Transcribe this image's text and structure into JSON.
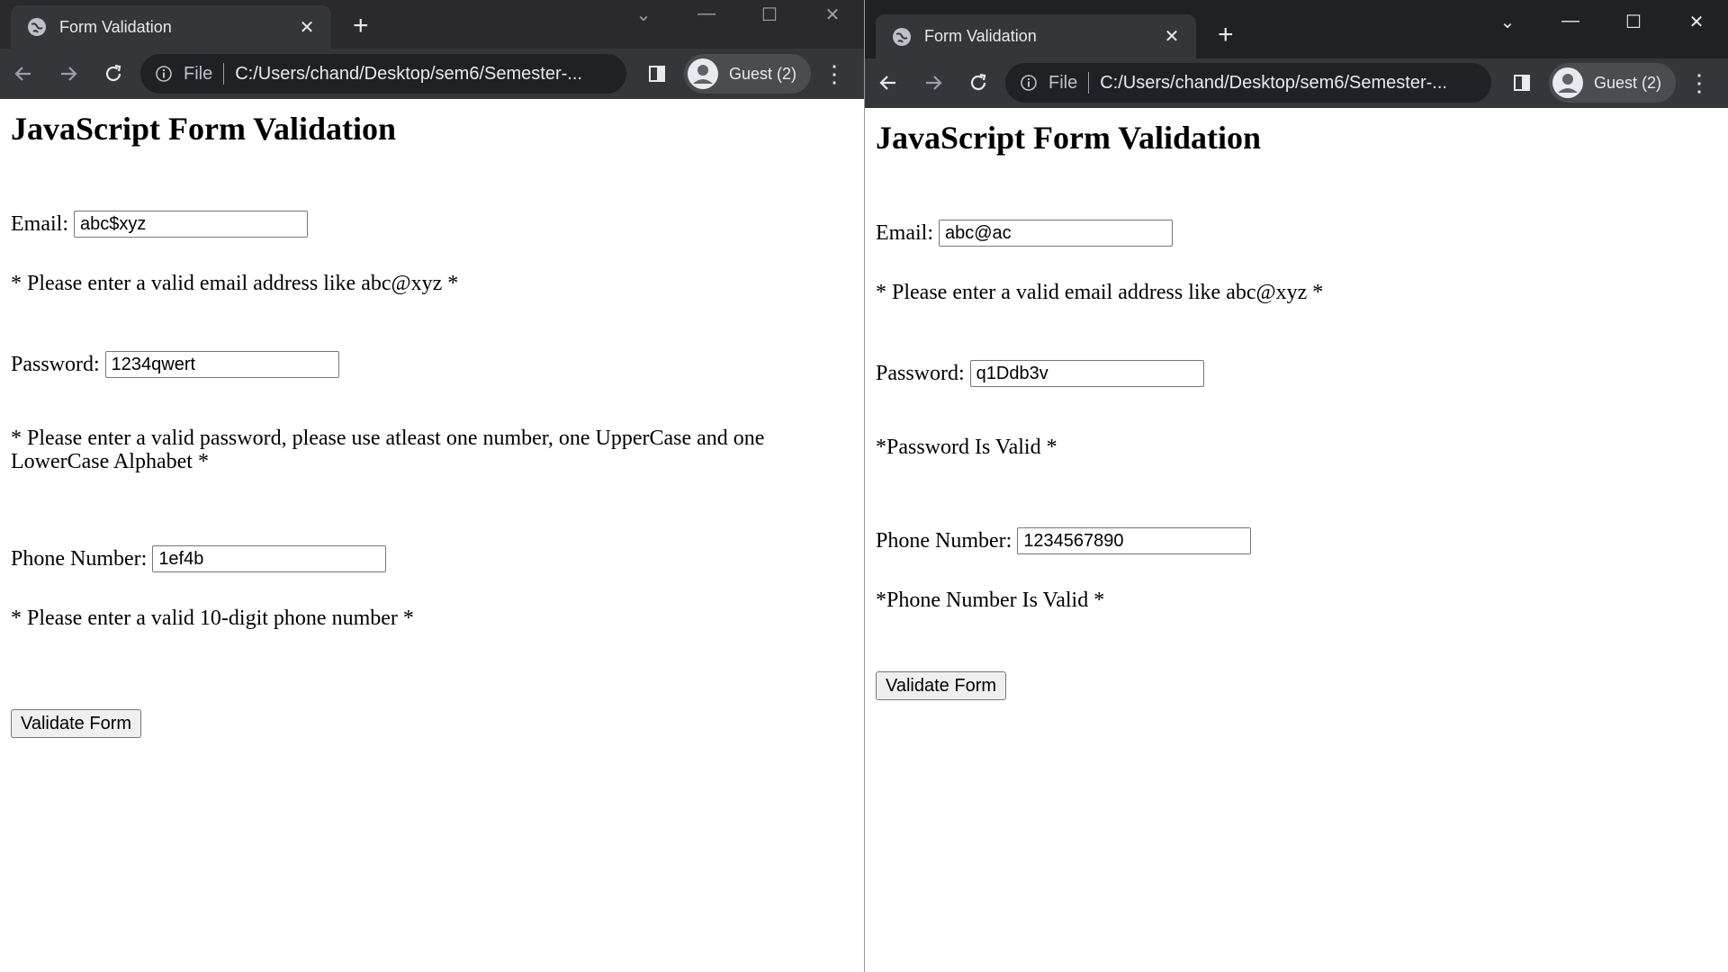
{
  "left_window": {
    "tab_title": "Form Validation",
    "url_scheme": "File",
    "url": "C:/Users/chand/Desktop/sem6/Semester-...",
    "profile_label": "Guest (2)",
    "page": {
      "heading": "JavaScript Form Validation",
      "email_label": "Email:",
      "email_value": "abc$xyz",
      "email_message": "* Please enter a valid email address like abc@xyz *",
      "password_label": "Password:",
      "password_value": "1234qwert",
      "password_message": "* Please enter a valid password, please use atleast one number, one UpperCase and one LowerCase Alphabet *",
      "phone_label": "Phone Number:",
      "phone_value": "1ef4b",
      "phone_message": "* Please enter a valid 10-digit phone number *",
      "button_label": "Validate Form"
    }
  },
  "right_window": {
    "tab_title": "Form Validation",
    "url_scheme": "File",
    "url": "C:/Users/chand/Desktop/sem6/Semester-...",
    "profile_label": "Guest (2)",
    "page": {
      "heading": "JavaScript Form Validation",
      "email_label": "Email:",
      "email_value": "abc@ac",
      "email_message": "* Please enter a valid email address like abc@xyz *",
      "password_label": "Password:",
      "password_value": "q1Ddb3v",
      "password_message": "*Password Is Valid *",
      "phone_label": "Phone Number:",
      "phone_value": "1234567890",
      "phone_message": "*Phone Number Is Valid *",
      "button_label": "Validate Form"
    }
  }
}
